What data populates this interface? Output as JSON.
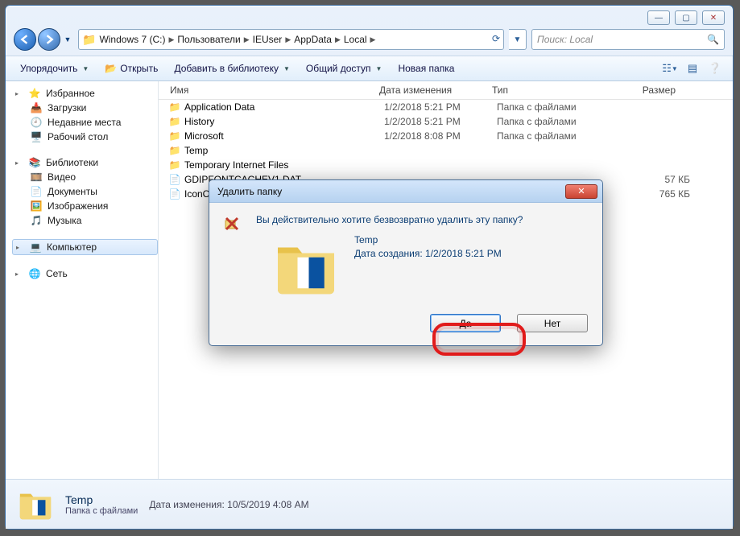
{
  "breadcrumb": [
    "Windows 7 (C:)",
    "Пользователи",
    "IEUser",
    "AppData",
    "Local"
  ],
  "search": {
    "placeholder": "Поиск: Local"
  },
  "toolbar": {
    "organize": "Упорядочить",
    "open": "Открыть",
    "addlib": "Добавить в библиотеку",
    "share": "Общий доступ",
    "newfolder": "Новая папка"
  },
  "nav": {
    "favorites": {
      "label": "Избранное",
      "items": [
        "Загрузки",
        "Недавние места",
        "Рабочий стол"
      ]
    },
    "libraries": {
      "label": "Библиотеки",
      "items": [
        "Видео",
        "Документы",
        "Изображения",
        "Музыка"
      ]
    },
    "computer": {
      "label": "Компьютер"
    },
    "network": {
      "label": "Сеть"
    }
  },
  "columns": {
    "name": "Имя",
    "date": "Дата изменения",
    "type": "Тип",
    "size": "Размер"
  },
  "rows": [
    {
      "icon": "shortcut",
      "name": "Application Data",
      "date": "1/2/2018 5:21 PM",
      "type": "Папка с файлами",
      "size": ""
    },
    {
      "icon": "shortcut",
      "name": "History",
      "date": "1/2/2018 5:21 PM",
      "type": "Папка с файлами",
      "size": ""
    },
    {
      "icon": "folder",
      "name": "Microsoft",
      "date": "1/2/2018 8:08 PM",
      "type": "Папка с файлами",
      "size": ""
    },
    {
      "icon": "folder",
      "name": "Temp",
      "date": "",
      "type": "",
      "size": ""
    },
    {
      "icon": "shortcut",
      "name": "Temporary Internet Files",
      "date": "",
      "type": "",
      "size": ""
    },
    {
      "icon": "file",
      "name": "GDIPFONTCACHEV1.DAT",
      "date": "",
      "type": "",
      "size": "57 КБ"
    },
    {
      "icon": "file",
      "name": "IconCache.db",
      "date": "",
      "type": "",
      "size": "765 КБ"
    }
  ],
  "preview": {
    "name": "Temp",
    "type": "Папка с файлами",
    "meta_label": "Дата изменения:",
    "meta_value": "10/5/2019 4:08 AM"
  },
  "dialog": {
    "title": "Удалить папку",
    "message": "Вы действительно хотите безвозвратно удалить эту папку?",
    "item_name": "Temp",
    "item_meta": "Дата создания: 1/2/2018 5:21 PM",
    "yes": "Да",
    "no": "Нет"
  }
}
